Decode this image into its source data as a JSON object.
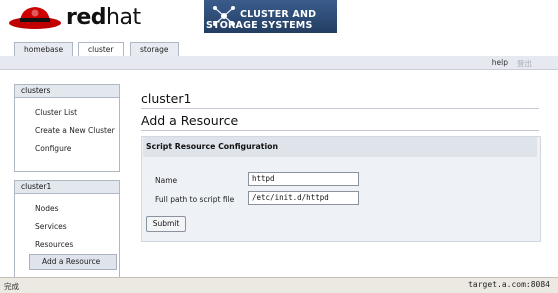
{
  "header": {
    "logo": {
      "brand_bold": "red",
      "brand_light": "hat"
    },
    "product_banner": {
      "line1": "CLUSTER AND",
      "line2": "STORAGE SYSTEMS"
    }
  },
  "tabs": [
    {
      "label": "homebase",
      "active": false
    },
    {
      "label": "cluster",
      "active": true
    },
    {
      "label": "storage",
      "active": false
    }
  ],
  "utility": {
    "help": "help",
    "logout": "登出"
  },
  "sidebar": {
    "clusters": {
      "title": "clusters",
      "items": [
        "Cluster List",
        "Create a New Cluster",
        "Configure"
      ]
    },
    "cluster1": {
      "title": "cluster1",
      "items": [
        "Nodes",
        "Services",
        "Resources",
        "Add a Resource"
      ],
      "selected": "Add a Resource"
    }
  },
  "main": {
    "cluster_title": "cluster1",
    "page_title": "Add a Resource",
    "form": {
      "title": "Script Resource Configuration",
      "name_label": "Name",
      "name_value": "httpd",
      "path_label": "Full path to script file",
      "path_value": "/etc/init.d/httpd",
      "submit_label": "Submit"
    }
  },
  "statusbar": {
    "left": "完成",
    "right": "target.a.com:8084"
  },
  "colors": {
    "brand_red": "#cc0000",
    "banner_blue": "#2c4a73",
    "panel_header": "#e3e8ef"
  }
}
